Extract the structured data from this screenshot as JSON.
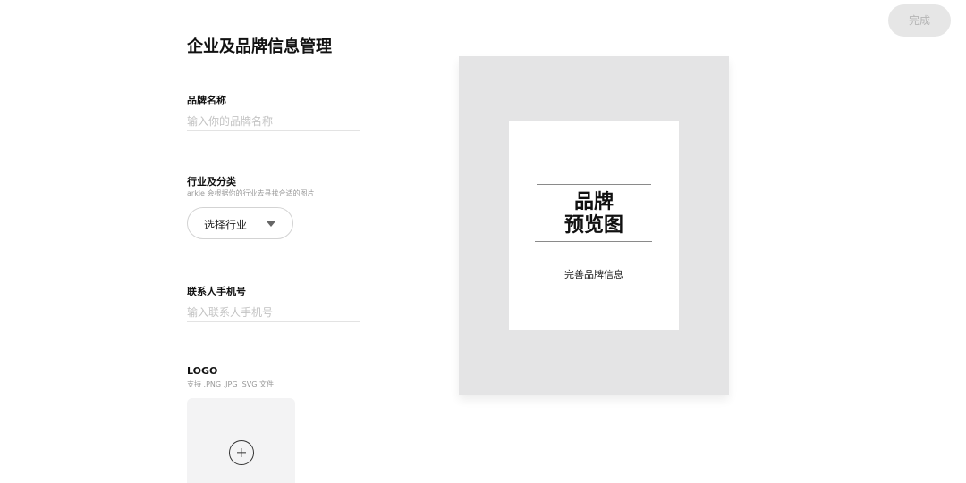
{
  "header": {
    "done_label": "完成"
  },
  "form": {
    "title": "企业及品牌信息管理",
    "brand_name": {
      "label": "品牌名称",
      "placeholder": "输入你的品牌名称"
    },
    "industry": {
      "label": "行业及分类",
      "hint": "arkie 会根据你的行业去寻找合适的图片",
      "select_label": "选择行业"
    },
    "phone": {
      "label": "联系人手机号",
      "placeholder": "输入联系人手机号"
    },
    "logo": {
      "label": "LOGO",
      "hint": "支持 .PNG .JPG .SVG 文件"
    }
  },
  "preview": {
    "title_line1": "品牌",
    "title_line2": "预览图",
    "subtitle": "完善品牌信息"
  },
  "icons": {
    "dropdown": "caret-down-icon",
    "upload": "plus-circle-icon"
  },
  "colors": {
    "preview_background": "#e4e4e5",
    "done_button_background": "#e6e6e6",
    "done_button_text": "#b5b5b5"
  }
}
